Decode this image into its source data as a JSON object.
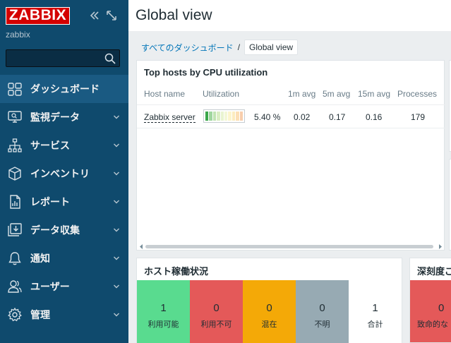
{
  "sidebar": {
    "logo": "ZABBIX",
    "server_name": "zabbix",
    "search": {
      "value": "",
      "placeholder": ""
    },
    "items": [
      {
        "label": "ダッシュボード",
        "icon": "dashboard-icon",
        "active": true
      },
      {
        "label": "監視データ",
        "icon": "monitoring-icon",
        "active": false
      },
      {
        "label": "サービス",
        "icon": "services-icon",
        "active": false
      },
      {
        "label": "インベントリ",
        "icon": "inventory-icon",
        "active": false
      },
      {
        "label": "レポート",
        "icon": "reports-icon",
        "active": false
      },
      {
        "label": "データ収集",
        "icon": "data-collection-icon",
        "active": false
      },
      {
        "label": "通知",
        "icon": "alerts-icon",
        "active": false
      },
      {
        "label": "ユーザー",
        "icon": "users-icon",
        "active": false
      },
      {
        "label": "管理",
        "icon": "administration-icon",
        "active": false
      }
    ]
  },
  "header": {
    "title": "Global view"
  },
  "breadcrumb": {
    "parent": "すべてのダッシュボード",
    "separator": "/",
    "current": "Global view"
  },
  "top_hosts": {
    "title": "Top hosts by CPU utilization",
    "columns": [
      "Host name",
      "Utilization",
      "1m avg",
      "5m avg",
      "15m avg",
      "Processes"
    ],
    "rows": [
      {
        "host": "Zabbix server",
        "utilization": "5.40 %",
        "utilization_fraction": 0.054,
        "avg1": "0.02",
        "avg5": "0.17",
        "avg15": "0.16",
        "processes": "179"
      }
    ]
  },
  "host_availability": {
    "title": "ホスト稼働状況",
    "cells": [
      {
        "count": "1",
        "label": "利用可能",
        "color": "#59db8f"
      },
      {
        "count": "0",
        "label": "利用不可",
        "color": "#e45959"
      },
      {
        "count": "0",
        "label": "混在",
        "color": "#f4a907"
      },
      {
        "count": "0",
        "label": "不明",
        "color": "#97aab3"
      },
      {
        "count": "1",
        "label": "合計",
        "color": "#ffffff"
      }
    ]
  },
  "severity": {
    "title": "深刻度ご",
    "count": "0",
    "label": "致命的な",
    "color": "#e45959"
  },
  "colors": {
    "sidebar_bg": "#0f4a6d",
    "accent_link": "#0275b8",
    "logo_red": "#d40000"
  }
}
